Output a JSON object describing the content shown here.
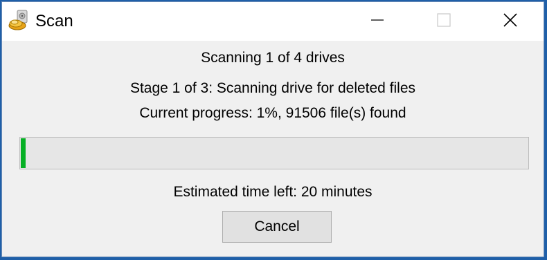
{
  "window": {
    "title": "Scan",
    "icon": "scan-drive-icon",
    "controls": [
      "minimize-icon",
      "maximize-icon",
      "close-icon"
    ]
  },
  "status": {
    "drives_line": "Scanning 1 of 4 drives",
    "stage_line": "Stage 1 of 3: Scanning drive for deleted files",
    "progress_line": "Current progress: 1%, 91506 file(s) found",
    "eta_line": "Estimated time left: 20 minutes"
  },
  "progress": {
    "percent": 1,
    "color": "#06b025"
  },
  "buttons": {
    "cancel_label": "Cancel"
  },
  "colors": {
    "frame": "#1f5fa8",
    "titlebar": "#ffffff",
    "dialog_bg": "#f0f0f0"
  }
}
